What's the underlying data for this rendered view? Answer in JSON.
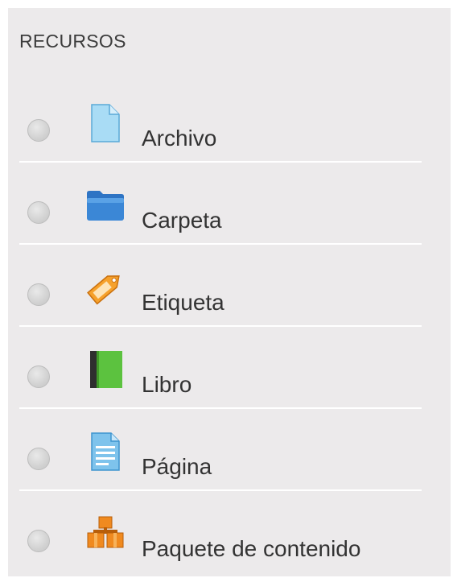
{
  "section": {
    "title": "RECURSOS"
  },
  "resources": [
    {
      "label": "Archivo",
      "icon": "file-icon"
    },
    {
      "label": "Carpeta",
      "icon": "folder-icon"
    },
    {
      "label": "Etiqueta",
      "icon": "tag-icon"
    },
    {
      "label": "Libro",
      "icon": "book-icon"
    },
    {
      "label": "Página",
      "icon": "page-icon"
    },
    {
      "label": "Paquete de contenido",
      "icon": "package-icon"
    }
  ],
  "colors": {
    "panel_background": "#eceaeb",
    "separator": "#ffffff",
    "text": "#333333",
    "file_icon": "#a9dcf5",
    "folder_icon": "#3b87d6",
    "tag_icon": "#f6a12b",
    "book_icon": "#5cc23f",
    "page_icon": "#7ec3ec",
    "package_icon": "#f08a1f"
  }
}
